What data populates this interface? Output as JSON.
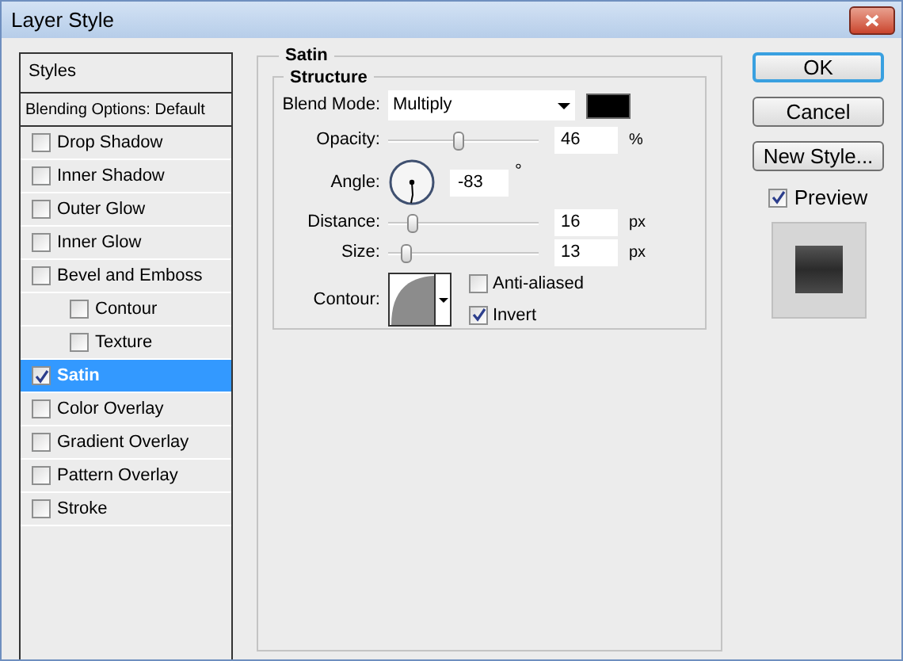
{
  "window": {
    "title": "Layer Style"
  },
  "sidebar": {
    "header": "Styles",
    "items": [
      {
        "label": "Blending Options: Default",
        "kind": "heading",
        "selected": false
      },
      {
        "label": "Drop Shadow",
        "kind": "check",
        "checked": false,
        "selected": false
      },
      {
        "label": "Inner Shadow",
        "kind": "check",
        "checked": false,
        "selected": false
      },
      {
        "label": "Outer Glow",
        "kind": "check",
        "checked": false,
        "selected": false
      },
      {
        "label": "Inner Glow",
        "kind": "check",
        "checked": false,
        "selected": false
      },
      {
        "label": "Bevel and Emboss",
        "kind": "check",
        "checked": false,
        "selected": false,
        "children": [
          {
            "label": "Contour",
            "kind": "check",
            "checked": false,
            "selected": false
          },
          {
            "label": "Texture",
            "kind": "check",
            "checked": false,
            "selected": false
          }
        ]
      },
      {
        "label": "Satin",
        "kind": "check",
        "checked": true,
        "selected": true
      },
      {
        "label": "Color Overlay",
        "kind": "check",
        "checked": false,
        "selected": false
      },
      {
        "label": "Gradient Overlay",
        "kind": "check",
        "checked": false,
        "selected": false
      },
      {
        "label": "Pattern Overlay",
        "kind": "check",
        "checked": false,
        "selected": false
      },
      {
        "label": "Stroke",
        "kind": "check",
        "checked": false,
        "selected": false
      }
    ]
  },
  "panel": {
    "title": "Satin",
    "group": "Structure",
    "blend_mode": {
      "label": "Blend Mode:",
      "value": "Multiply",
      "color": "#000000"
    },
    "opacity": {
      "label": "Opacity:",
      "level": 0.46,
      "value": "46",
      "unit": "%"
    },
    "angle": {
      "label": "Angle:",
      "value": "-83",
      "unit": "°"
    },
    "distance": {
      "label": "Distance:",
      "level": 0.16,
      "value": "16",
      "unit": "px"
    },
    "size": {
      "label": "Size:",
      "level": 0.12,
      "value": "13",
      "unit": "px"
    },
    "contour": {
      "label": "Contour:",
      "anti_aliased": {
        "label": "Anti-aliased",
        "checked": false
      },
      "invert": {
        "label": "Invert",
        "checked": true
      }
    }
  },
  "buttons": [
    {
      "label": "OK",
      "focused": true
    },
    {
      "label": "Cancel",
      "focused": false
    },
    {
      "label": "New Style...",
      "focused": false
    }
  ],
  "preview": {
    "label": "Preview",
    "checked": true
  }
}
